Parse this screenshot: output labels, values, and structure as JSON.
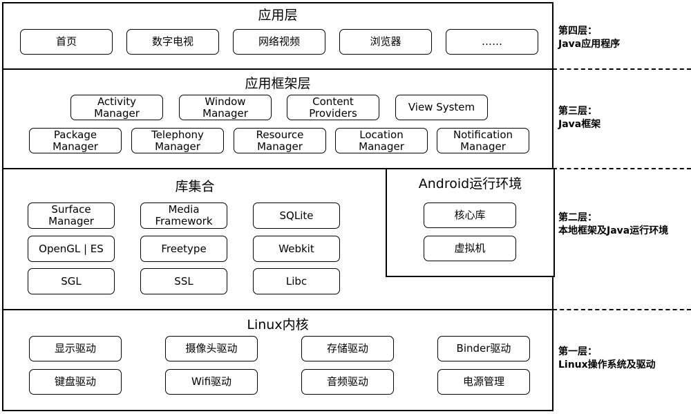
{
  "layers": [
    {
      "title": "应用层",
      "side_label": [
        "第四层：",
        "Java应用程序"
      ],
      "boxes": [
        "首页",
        "数字电视",
        "网络视频",
        "浏览器",
        "……"
      ]
    },
    {
      "title": "应用框架层",
      "side_label": [
        "第三层：",
        "Java框架"
      ],
      "boxes_row1": [
        "Activity\nManager",
        "Window\nManager",
        "Content\nProviders",
        "View System"
      ],
      "boxes_row2": [
        "Package\nManager",
        "Telephony\nManager",
        "Resource\nManager",
        "Location\nManager",
        "Notification\nManager"
      ]
    },
    {
      "title": "库集合",
      "side_label": [
        "第二层：",
        "本地框架及Java运行环境"
      ],
      "boxes": [
        "Surface\nManager",
        "Media\nFramework",
        "SQLite",
        "OpenGL | ES",
        "Freetype",
        "Webkit",
        "SGL",
        "SSL",
        "Libc"
      ],
      "runtime": {
        "title": "Android运行环境",
        "boxes": [
          "核心库",
          "虚拟机"
        ]
      }
    },
    {
      "title": "Linux内核",
      "side_label": [
        "第一层：",
        "Linux操作系统及驱动"
      ],
      "boxes": [
        "显示驱动",
        "摄像头驱动",
        "存储驱动",
        "Binder驱动",
        "键盘驱动",
        "Wifi驱动",
        "音频驱动",
        "电源管理"
      ]
    }
  ]
}
